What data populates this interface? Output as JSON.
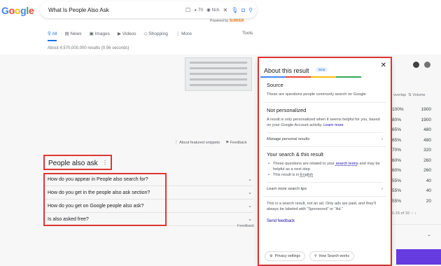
{
  "logo": "Google",
  "search": {
    "query": "What Is People Also Ask",
    "metric_1": "70",
    "metric_2": "N/A",
    "powered_label": "Powered by",
    "powered_brand": "SURFER"
  },
  "tabs": [
    "All",
    "News",
    "Images",
    "Videos",
    "Shopping",
    "More"
  ],
  "tools_label": "Tools",
  "results_stats": "About 4,570,000,000 results (0.56 seconds)",
  "snippet_footer": {
    "about": "About featured snippets",
    "feedback": "Feedback"
  },
  "paa": {
    "title": "People also ask",
    "more": "⋮",
    "questions": [
      "How do you appear in People also search for?",
      "How do you get in the people also ask section?",
      "How do you get on Google people also ask?",
      "Is also asked free?"
    ],
    "feedback": "Feedback"
  },
  "side": {
    "header_left": "overlap",
    "header_right": "Volume",
    "rows": [
      {
        "pct": "100%",
        "vol": "1900"
      },
      {
        "pct": "80%",
        "vol": "1900"
      },
      {
        "pct": "65%",
        "vol": "480"
      },
      {
        "pct": "65%",
        "vol": "480"
      },
      {
        "pct": "70%",
        "vol": "320"
      },
      {
        "pct": "60%",
        "vol": "260"
      },
      {
        "pct": "60%",
        "vol": "260"
      },
      {
        "pct": "55%",
        "vol": "40"
      },
      {
        "pct": "55%",
        "vol": "40"
      },
      {
        "pct": "55%",
        "vol": "20"
      }
    ],
    "pager": "1-15 of 10"
  },
  "panel": {
    "title": "About this result",
    "beta": "Beta",
    "source_title": "Source",
    "source_text": "These are questions people commonly search on Google",
    "np_title": "Not personalized",
    "np_text": "A result is only personalized when it seems helpful for you, based on your Google Account activity.",
    "np_link": "Learn more",
    "manage_label": "Manage personal results",
    "ys_title": "Your search & this result",
    "ys_b1_pre": "These questions are related to your",
    "ys_b1_link": "search terms",
    "ys_b1_post": "and may be helpful as a next step",
    "ys_b2_pre": "This result is in",
    "ys_b2_link": "English",
    "tips_label": "Learn more search tips",
    "ad_text": "This is a search result, not an ad. Only ads are paid, and they'll always be labeled with \"Sponsored\" or \"Ad.\"",
    "send_feedback": "Send feedback",
    "privacy_label": "Privacy settings",
    "how_label": "How Search works"
  },
  "colors": {
    "accent": "#1a73e8",
    "highlight_box": "#e53935",
    "bar": [
      "#4285f4",
      "#ea4335",
      "#fbbc05",
      "#34a853"
    ]
  }
}
